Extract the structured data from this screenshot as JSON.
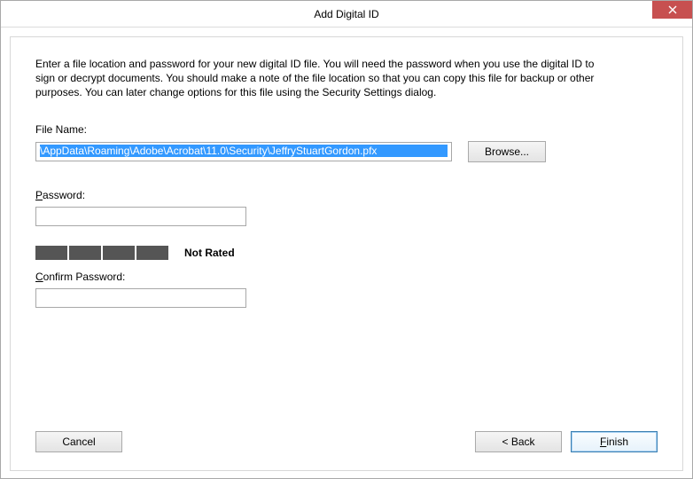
{
  "window": {
    "title": "Add Digital ID"
  },
  "description": "Enter a file location and password for your new digital ID file. You will need the password when you use the digital ID to sign or decrypt documents. You should make a note of the file location so that you can copy this file for backup or other purposes. You can later change options for this file using the Security Settings dialog.",
  "labels": {
    "file_name": "File Name:",
    "password": "Password:",
    "confirm_password": "Confirm Password:"
  },
  "file_name": {
    "value": "\\AppData\\Roaming\\Adobe\\Acrobat\\11.0\\Security\\JeffryStuartGordon.pfx"
  },
  "buttons": {
    "browse": "Browse...",
    "cancel": "Cancel",
    "back": "< Back",
    "finish_prefix": "",
    "finish_u": "F",
    "finish_rest": "inish"
  },
  "password": {
    "value": "",
    "strength_label": "Not Rated"
  },
  "confirm_password": {
    "value": ""
  }
}
